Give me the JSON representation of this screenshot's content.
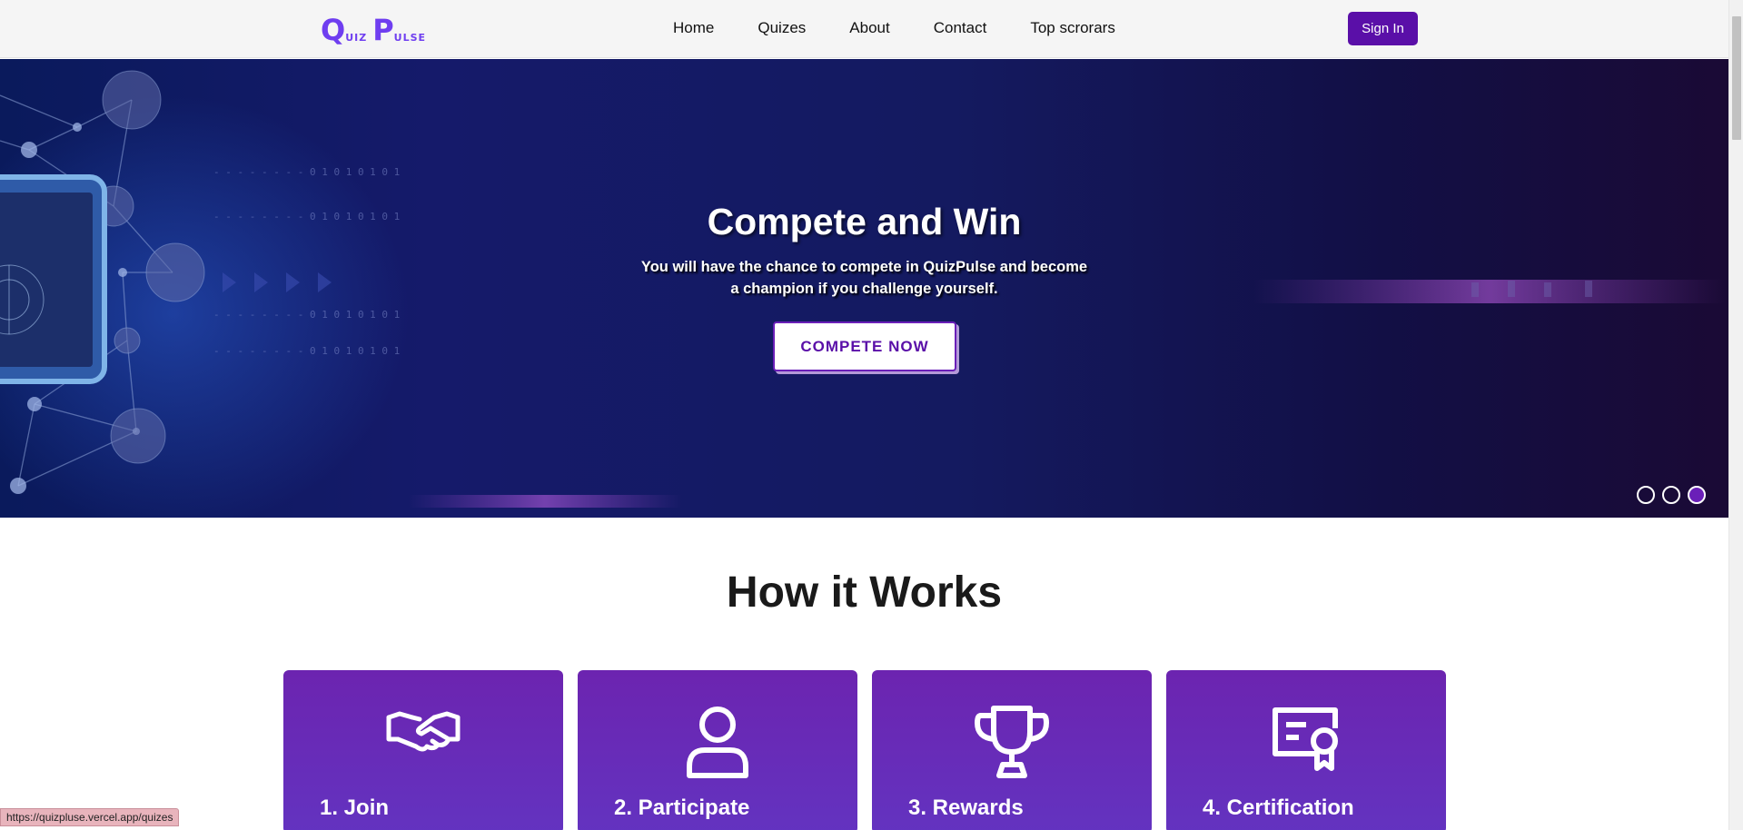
{
  "logo": {
    "letter1": "Q",
    "rest1": "UIZ",
    "letter2": "P",
    "rest2": "ULSE",
    "color": "#6f3ef0"
  },
  "nav": {
    "links": [
      "Home",
      "Quizes",
      "About",
      "Contact",
      "Top scrorars"
    ],
    "signin_label": "Sign In"
  },
  "hero": {
    "title": "Compete and Win",
    "subtitle": "You will have the chance to compete in QuizPulse and become a champion if you challenge yourself.",
    "cta_label": "COMPETE NOW",
    "slides_total": 3,
    "active_slide": 3
  },
  "how_it_works": {
    "title": "How it Works",
    "cards": [
      {
        "label": "1. Join",
        "icon": "handshake-icon"
      },
      {
        "label": "2. Participate",
        "icon": "user-icon"
      },
      {
        "label": "3. Rewards",
        "icon": "trophy-icon"
      },
      {
        "label": "4. Certification",
        "icon": "certificate-icon"
      }
    ]
  },
  "status_bar": {
    "url": "https://quizpluse.vercel.app/quizes"
  },
  "colors": {
    "accent": "#5a0fa8",
    "card": "#6a2bb8",
    "hero_bg": "#141a60"
  }
}
